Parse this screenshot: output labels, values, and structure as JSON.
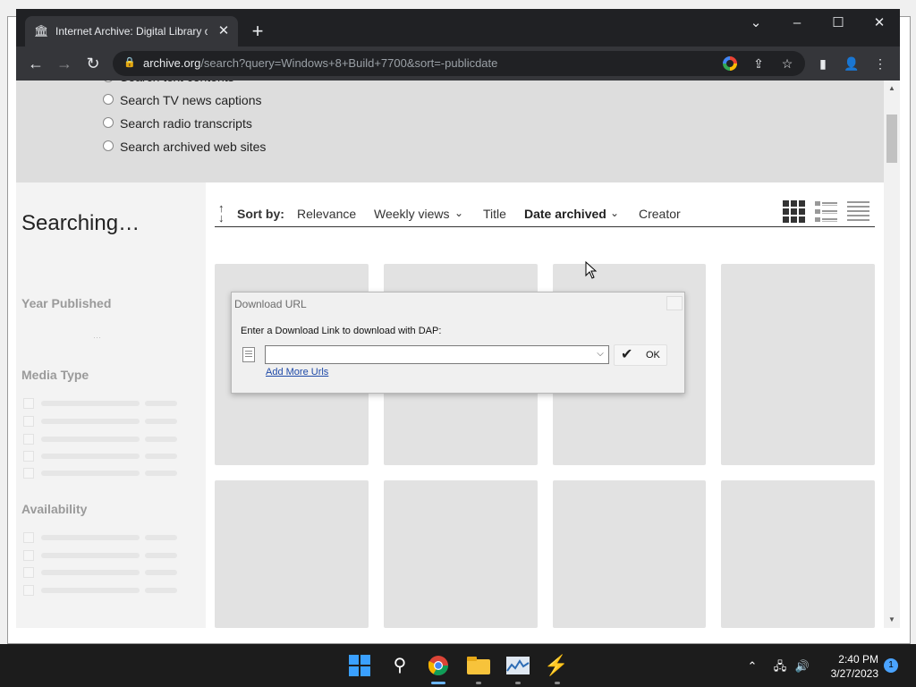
{
  "browser": {
    "tab_title": "Internet Archive: Digital Library o",
    "url_host": "archive.org",
    "url_path": "/search?query=Windows+8+Build+7700&sort=-publicdate"
  },
  "search_options": [
    {
      "label": "Search text contents"
    },
    {
      "label": "Search TV news captions"
    },
    {
      "label": "Search radio transcripts"
    },
    {
      "label": "Search archived web sites"
    }
  ],
  "sidebar": {
    "status": "Searching…",
    "facets": [
      "Year Published",
      "Media Type",
      "Availability"
    ]
  },
  "sort": {
    "label": "Sort by:",
    "options": [
      "Relevance",
      "Weekly views",
      "Title",
      "Date archived",
      "Creator"
    ],
    "active": "Date archived"
  },
  "dialog": {
    "title": "Download URL",
    "prompt": "Enter a Download Link to download with DAP:",
    "input_value": "",
    "ok_label": "OK",
    "link_label": "Add More Urls"
  },
  "taskbar": {
    "time": "2:40 PM",
    "date": "3/27/2023",
    "notification_count": "1"
  },
  "colors": {
    "chrome_dark": "#202124",
    "toolbar": "#35363a",
    "tile_placeholder": "#e2e2e2",
    "link": "#1f4aa8"
  }
}
